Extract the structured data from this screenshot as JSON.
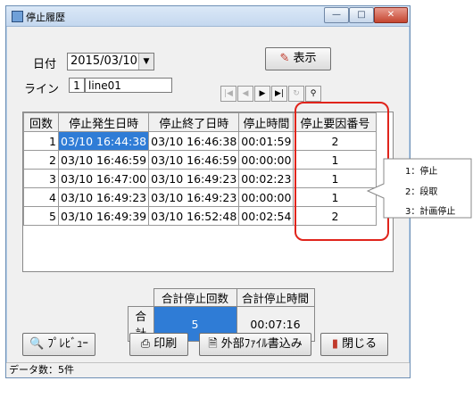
{
  "window": {
    "title": "停止履歴"
  },
  "filters": {
    "date_label": "日付",
    "date_value": "2015/03/10",
    "line_label": "ライン",
    "line_number": "1",
    "line_name": "line01",
    "show_button": "表示"
  },
  "table": {
    "headers": [
      "回数",
      "停止発生日時",
      "停止終了日時",
      "停止時間",
      "停止要因番号"
    ],
    "rows": [
      [
        "1",
        "03/10 16:44:38",
        "03/10 16:46:38",
        "00:01:59",
        "2"
      ],
      [
        "2",
        "03/10 16:46:59",
        "03/10 16:46:59",
        "00:00:00",
        "1"
      ],
      [
        "3",
        "03/10 16:47:00",
        "03/10 16:49:23",
        "00:02:23",
        "1"
      ],
      [
        "4",
        "03/10 16:49:23",
        "03/10 16:49:23",
        "00:00:00",
        "1"
      ],
      [
        "5",
        "03/10 16:49:39",
        "03/10 16:52:48",
        "00:02:54",
        "2"
      ]
    ]
  },
  "callout": {
    "items": [
      "1：停止",
      "2：段取",
      "3：計画停止"
    ]
  },
  "summary": {
    "header_count": "合計停止回数",
    "header_time": "合計停止時間",
    "row_label": "合計",
    "count": "5",
    "time": "00:07:16"
  },
  "buttons": {
    "preview": "ﾌﾟﾚﾋﾞｭｰ",
    "print": "印刷",
    "export": "外部ﾌｧｲﾙ書込み",
    "close": "閉じる"
  },
  "status": {
    "text": "データ数：5件"
  }
}
